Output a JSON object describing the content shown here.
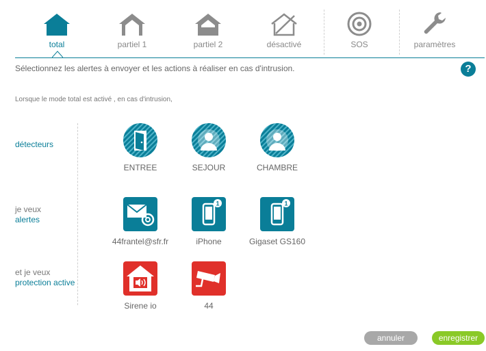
{
  "tabs": [
    {
      "label": "total",
      "icon": "house-filled-icon"
    },
    {
      "label": "partiel 1",
      "icon": "house-partial-icon"
    },
    {
      "label": "partiel 2",
      "icon": "house-partial-icon"
    },
    {
      "label": "désactivé",
      "icon": "house-disabled-icon"
    },
    {
      "label": "SOS",
      "icon": "sos-target-icon"
    },
    {
      "label": "paramètres",
      "icon": "wrench-icon"
    }
  ],
  "intro": "Sélectionnez les alertes à envoyer et les actions à réaliser en cas d'intrusion.",
  "help_label": "?",
  "subtitle": "Lorsque le mode total est activé , en cas d'intrusion,",
  "rows": {
    "detecteurs": {
      "label": "détecteurs"
    },
    "alertes": {
      "label_1": "je veux",
      "label_2": "alertes"
    },
    "protection": {
      "label_1": "et je veux",
      "label_2": "protection active"
    }
  },
  "detectors": [
    {
      "name": "ENTREE",
      "icon": "door-icon"
    },
    {
      "name": "SEJOUR",
      "icon": "motion-sensor-icon"
    },
    {
      "name": "CHAMBRE",
      "icon": "motion-sensor-icon"
    }
  ],
  "alerts": [
    {
      "name": "44frantel@sfr.fr",
      "icon": "email-icon"
    },
    {
      "name": "iPhone",
      "icon": "phone-icon",
      "badge": "1"
    },
    {
      "name": "Gigaset GS160",
      "icon": "phone-icon",
      "badge": "1"
    }
  ],
  "protection": [
    {
      "name": "Sirene io",
      "icon": "siren-icon"
    },
    {
      "name": "44",
      "icon": "camera-icon"
    }
  ],
  "buttons": {
    "cancel": "annuler",
    "save": "enregistrer"
  },
  "colors": {
    "accent": "#0a7e98",
    "alert_red": "#e0302a",
    "save_green": "#8ac927",
    "cancel_grey": "#a8a8a8"
  }
}
